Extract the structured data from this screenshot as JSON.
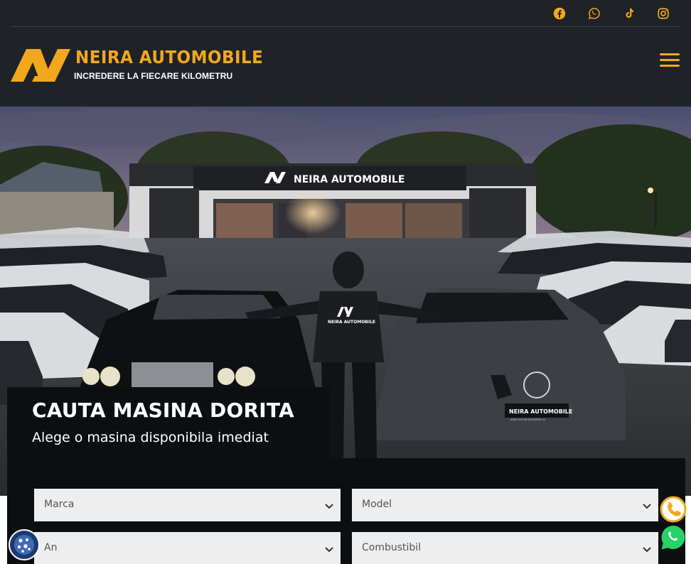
{
  "header": {
    "social": [
      {
        "name": "facebook",
        "icon": "facebook-icon"
      },
      {
        "name": "whatsapp",
        "icon": "whatsapp-icon"
      },
      {
        "name": "tiktok",
        "icon": "tiktok-icon"
      },
      {
        "name": "instagram",
        "icon": "instagram-icon"
      }
    ],
    "logo_name": "NEIRA  AUTOMOBILE",
    "logo_tagline": "INCREDERE LA FIECARE KILOMETRU",
    "menu_icon": "hamburger-menu-icon"
  },
  "hero": {
    "storefront_sign": "NEIRA AUTOMOBILE",
    "hoodie_text": "NEIRA AUTOMOBILE",
    "plate_text": "NEIRA AUTOMOBILE",
    "plate_small": "www.neiraautomobile.ro"
  },
  "search": {
    "title": "CAUTA MASINA DORITA",
    "subtitle": "Alege o masina disponibila imediat",
    "fields": {
      "make": "Marca",
      "model": "Model",
      "year": "An",
      "fuel": "Combustibil"
    }
  },
  "floating": {
    "phone_icon": "phone-icon",
    "whatsapp_icon": "whatsapp-icon",
    "cookie_icon": "cookie-icon"
  },
  "colors": {
    "accent": "#f2a81d",
    "header_bg": "#1f2327",
    "panel_bg": "#0c0f12",
    "whatsapp": "#25d366"
  }
}
